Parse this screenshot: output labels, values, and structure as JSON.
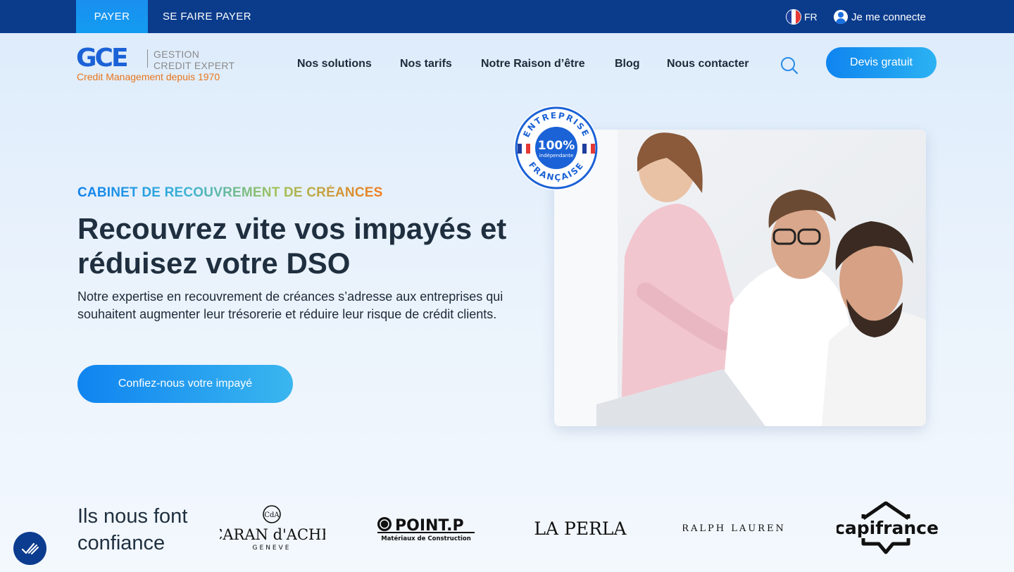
{
  "topbar": {
    "tabs": [
      {
        "label": "PAYER",
        "active": true
      },
      {
        "label": "SE FAIRE PAYER",
        "active": false
      }
    ],
    "language": "FR",
    "login_label": "Je me connecte",
    "colors": {
      "background": "#0b3c8c",
      "active_tab": "#1a8ff0"
    }
  },
  "header": {
    "logo": {
      "mark": "GCE",
      "line1": "GESTION",
      "line2": "CREDIT EXPERT",
      "tagline": "Credit Management depuis 1970"
    },
    "nav": [
      {
        "label": "Nos solutions"
      },
      {
        "label": "Nos tarifs"
      },
      {
        "label": "Notre Raison d’être"
      },
      {
        "label": "Blog"
      },
      {
        "label": "Nous contacter"
      }
    ],
    "search_icon": "search-icon",
    "quote_button": "Devis gratuit"
  },
  "hero": {
    "eyebrow": "CABINET DE RECOUVREMENT DE CRÉANCES",
    "title": "Recouvrez vite vos impayés et réduisez votre DSO",
    "text": "Notre expertise en recouvrement de créances s’adresse aux entreprises qui souhaitent augmenter leur trésorerie et réduire leur risque de crédit clients.",
    "cta": "Confiez-nous votre impayé",
    "badge": {
      "top_text": "ENTREPRISE",
      "bottom_text": "FRANÇAISE",
      "percent": "100%",
      "subtitle": "indépendante"
    }
  },
  "trust": {
    "title": "Ils nous font confiance",
    "clients": [
      {
        "name": "CARAN d'ACHE",
        "sub": "GENEVE",
        "mark": "CdA"
      },
      {
        "name": "POINT.P",
        "sub": "Matériaux de Construction"
      },
      {
        "name": "LA PERLA"
      },
      {
        "name": "RALPH LAUREN"
      },
      {
        "name": "capifrance"
      }
    ]
  },
  "colors": {
    "primary": "#0f84f0",
    "navy": "#0b3c8c",
    "orange": "#e8761b",
    "text": "#1d2a38"
  }
}
